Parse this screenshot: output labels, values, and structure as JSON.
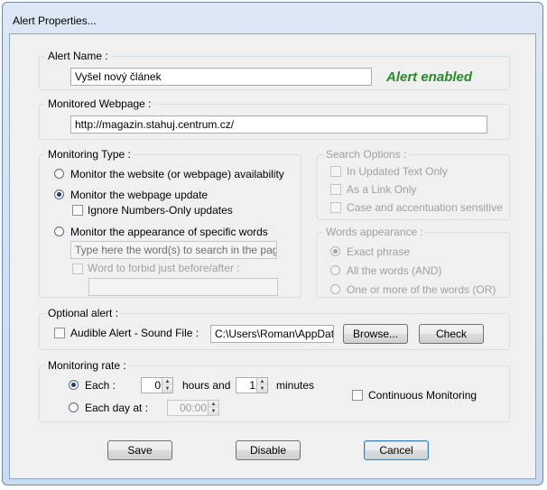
{
  "window": {
    "title": "Alert Properties..."
  },
  "alert_name": {
    "label": "Alert Name :",
    "value": "Vyšel nový článek",
    "status": "Alert enabled",
    "status_color": "#2a8a2a"
  },
  "monitored_webpage": {
    "label": "Monitored Webpage :",
    "value": "http://magazin.stahuj.centrum.cz/"
  },
  "monitoring_type": {
    "label": "Monitoring Type :",
    "availability": {
      "label": "Monitor the website (or webpage) availability",
      "selected": false
    },
    "update": {
      "label": "Monitor the webpage update",
      "selected": true
    },
    "numbers_only": {
      "label": "Ignore Numbers-Only updates",
      "checked": false
    },
    "specific_words": {
      "label": "Monitor the appearance of specific words",
      "selected": false
    },
    "words_placeholder": "Type here the word(s) to search in the page",
    "forbid_word": {
      "label": "Word to forbid just before/after :",
      "checked": false,
      "value": ""
    }
  },
  "search_options": {
    "label": "Search Options :",
    "updated_text_only": "In Updated Text Only",
    "as_link_only": "As a Link Only",
    "case_sensitive": "Case and accentuation sensitive"
  },
  "words_appearance": {
    "label": "Words appearance :",
    "exact_phrase": "Exact phrase",
    "all_words": "All the words (AND)",
    "one_or_more": "One or more of the words (OR)"
  },
  "optional_alert": {
    "label": "Optional alert :",
    "audible": "Audible Alert - Sound File :",
    "sound_file": "C:\\Users\\Roman\\AppData\\",
    "browse": "Browse...",
    "check": "Check"
  },
  "monitoring_rate": {
    "label": "Monitoring rate :",
    "each": "Each :",
    "hours_value": "0",
    "hours_and": "hours and",
    "minutes_value": "1",
    "minutes": "minutes",
    "each_day": "Each day at :",
    "time_value": "00:00",
    "continuous": "Continuous Monitoring"
  },
  "buttons": {
    "save": "Save",
    "disable": "Disable",
    "cancel": "Cancel"
  }
}
